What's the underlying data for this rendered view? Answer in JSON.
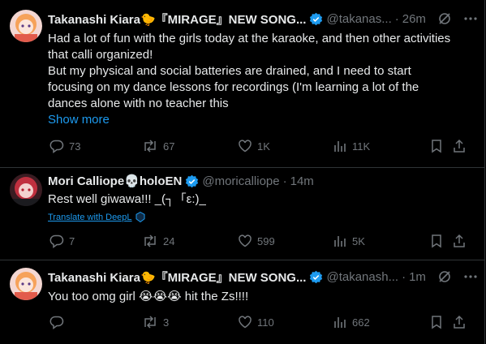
{
  "colors": {
    "background": "#000000",
    "accent": "#1d9bf0",
    "muted": "#71767b",
    "text": "#e7e9ea",
    "verified": "#1d9bf0"
  },
  "tweets": [
    {
      "name": "Takanashi Kiara🐤『MIRAGE』NEW SONG...",
      "handle": "@takanas...",
      "separator": "·",
      "time": "26m",
      "lines": [
        "Had a lot of fun with the girls today at the karaoke, and then other activities",
        "that calli organized!",
        "But my physical and social batteries are drained, and I need to start",
        "focusing on my dance lessons for recordings (I'm learning a lot of the",
        "dances alone with no teacher this"
      ],
      "show_more": "Show more",
      "replies": "73",
      "reposts": "67",
      "likes": "1K",
      "views": "11K"
    },
    {
      "name": "Mori Calliope💀holoEN",
      "handle": "@moricalliope",
      "separator": "·",
      "time": "14m",
      "lines": [
        "Rest well giwawa!!! _(┐「ε:)_"
      ],
      "translate": "Translate with DeepL",
      "replies": "7",
      "reposts": "24",
      "likes": "599",
      "views": "5K"
    },
    {
      "name": "Takanashi Kiara🐤『MIRAGE』NEW SONG...",
      "handle": "@takanash...",
      "separator": "·",
      "time": "1m",
      "lines": [
        "You too omg girl 😭😭😭 hit the Zs!!!!"
      ],
      "replies": "",
      "reposts": "3",
      "likes": "110",
      "views": "662"
    }
  ],
  "icons": [
    "verified-badge-icon",
    "grok-icon",
    "more-icon",
    "reply-icon",
    "repost-icon",
    "like-icon",
    "views-icon",
    "bookmark-icon",
    "share-icon",
    "deepl-icon"
  ]
}
